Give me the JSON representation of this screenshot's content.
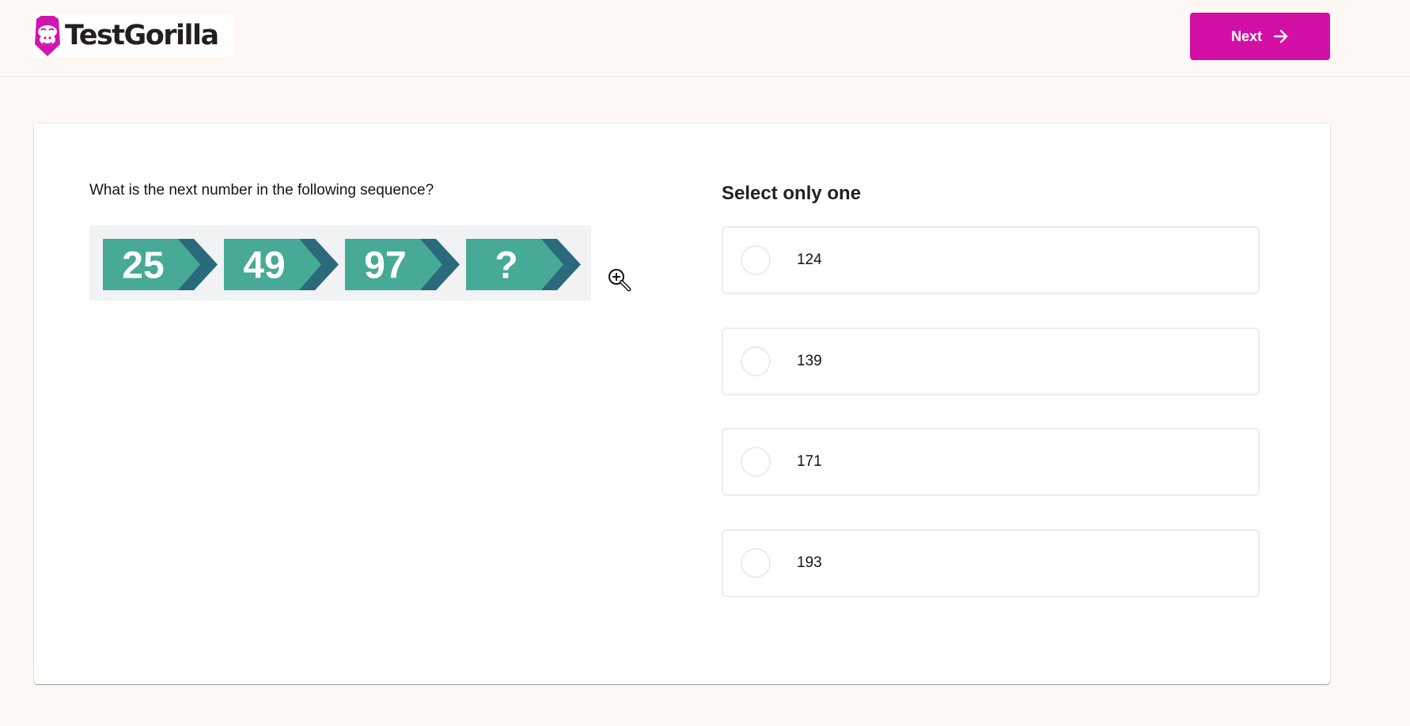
{
  "brand": {
    "name": "TestGorilla",
    "accent_color": "#d210a6",
    "logo_icon": "gorilla-face-icon"
  },
  "header": {
    "next_button": {
      "label": "Next",
      "icon": "arrow-right-icon"
    }
  },
  "question": {
    "prompt": "What is the next number in the following sequence?",
    "sequence": {
      "items": [
        "25",
        "49",
        "97",
        "?"
      ],
      "box_color": "#46aa96",
      "chevron_color": "#2a6a7a",
      "background_color": "#f1f2f4"
    },
    "zoom_icon": "zoom-in-icon"
  },
  "answers": {
    "heading": "Select only one",
    "options": [
      {
        "label": "124",
        "selected": false
      },
      {
        "label": "139",
        "selected": false
      },
      {
        "label": "171",
        "selected": false
      },
      {
        "label": "193",
        "selected": false
      }
    ]
  }
}
